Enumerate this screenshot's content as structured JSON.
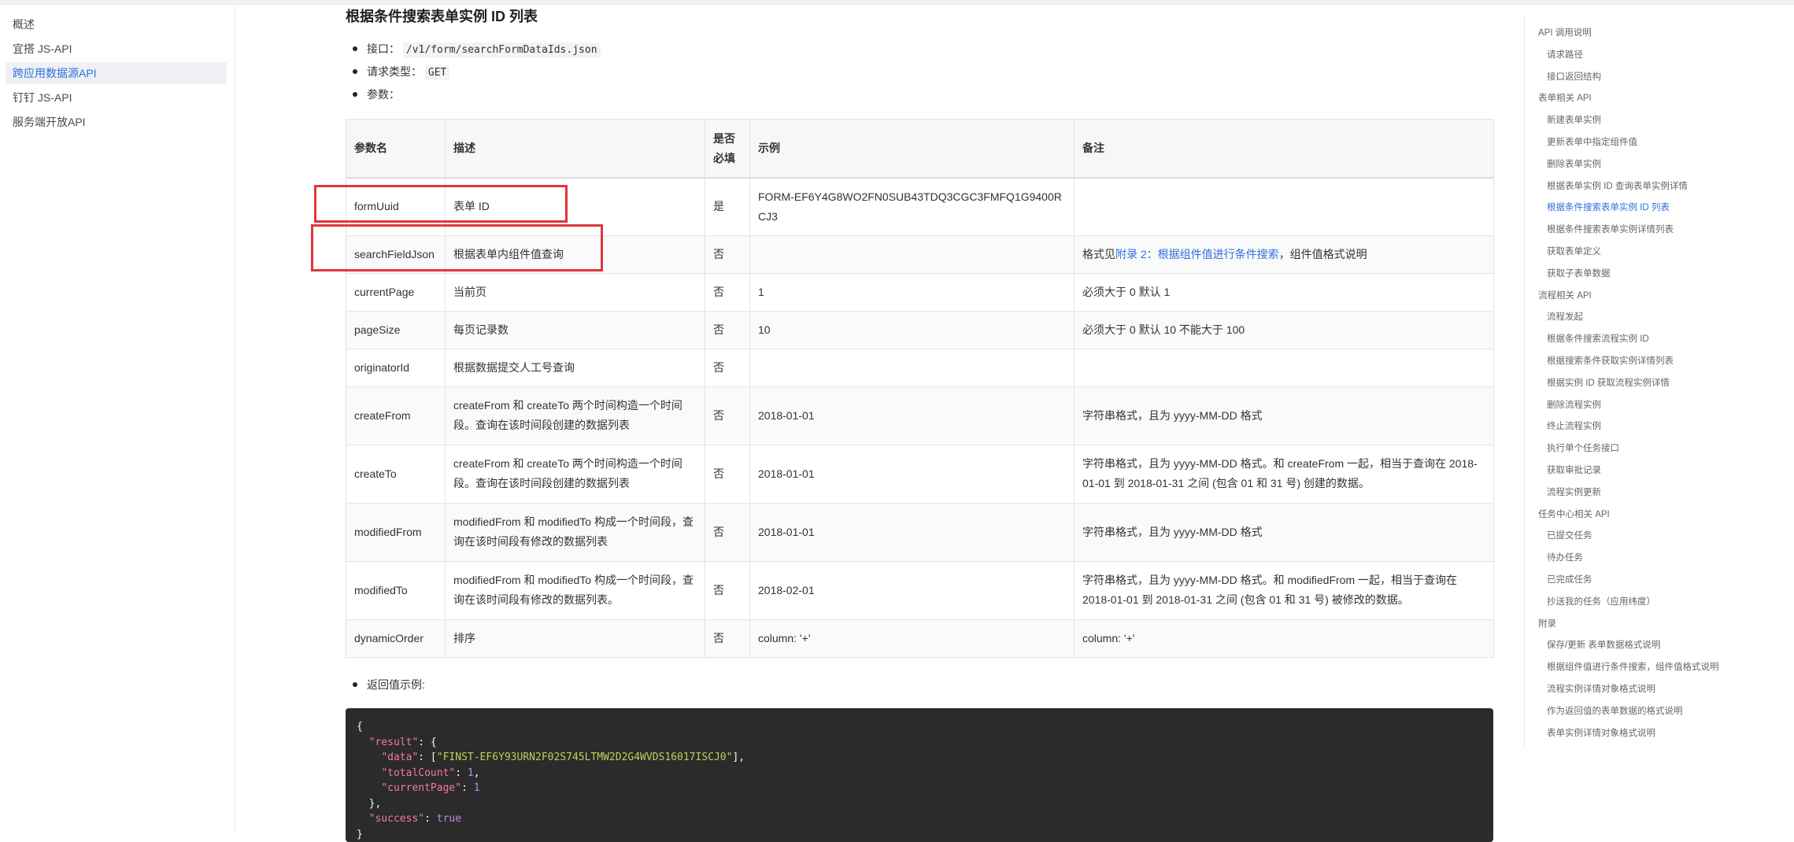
{
  "sidebar": {
    "items": [
      {
        "label": "概述",
        "active": false
      },
      {
        "label": "宜搭 JS-API",
        "active": false
      },
      {
        "label": "跨应用数据源API",
        "active": true
      },
      {
        "label": "钉钉 JS-API",
        "active": false
      },
      {
        "label": "服务端开放API",
        "active": false
      }
    ]
  },
  "main": {
    "title": "根据条件搜索表单实例 ID 列表",
    "endpoint_label": "接口：",
    "endpoint": "/v1/form/searchFormDataIds.json",
    "method_label": "请求类型：",
    "method": "GET",
    "params_label": "参数：",
    "table": {
      "headers": [
        "参数名",
        "描述",
        "是否必填",
        "示例",
        "备注"
      ],
      "rows": [
        {
          "name": "formUuid",
          "desc": "表单 ID",
          "required": "是",
          "example": "FORM-EF6Y4G8WO2FN0SUB43TDQ3CGC3FMFQ1G9400RCJ3",
          "note": ""
        },
        {
          "name": "searchFieldJson",
          "desc": "根据表单内组件值查询",
          "required": "否",
          "example": "",
          "note_pre": "格式见",
          "note_link": "附录 2：根据组件值进行条件搜索",
          "note_post": "，组件值格式说明"
        },
        {
          "name": "currentPage",
          "desc": "当前页",
          "required": "否",
          "example": "1",
          "note": "必须大于 0 默认 1"
        },
        {
          "name": "pageSize",
          "desc": "每页记录数",
          "required": "否",
          "example": "10",
          "note": "必须大于 0 默认 10 不能大于 100"
        },
        {
          "name": "originatorId",
          "desc": "根据数据提交人工号查询",
          "required": "否",
          "example": "",
          "note": ""
        },
        {
          "name": "createFrom",
          "desc": "createFrom 和 createTo 两个时间构造一个时间段。查询在该时间段创建的数据列表",
          "required": "否",
          "example": "2018-01-01",
          "note": "字符串格式，且为 yyyy-MM-DD 格式"
        },
        {
          "name": "createTo",
          "desc": "createFrom 和 createTo 两个时间构造一个时间段。查询在该时间段创建的数据列表",
          "required": "否",
          "example": "2018-01-01",
          "note": "字符串格式，且为 yyyy-MM-DD 格式。和 createFrom 一起，相当于查询在 2018-01-01 到 2018-01-31 之间 (包含 01 和 31 号) 创建的数据。"
        },
        {
          "name": "modifiedFrom",
          "desc": "modifiedFrom 和 modifiedTo 构成一个时间段，查询在该时间段有修改的数据列表",
          "required": "否",
          "example": "2018-01-01",
          "note": "字符串格式，且为 yyyy-MM-DD 格式"
        },
        {
          "name": "modifiedTo",
          "desc": "modifiedFrom 和 modifiedTo 构成一个时间段，查询在该时间段有修改的数据列表。",
          "required": "否",
          "example": "2018-02-01",
          "note": "字符串格式，且为 yyyy-MM-DD 格式。和 modifiedFrom 一起，相当于查询在 2018-01-01 到 2018-01-31 之间 (包含 01 和 31 号) 被修改的数据。"
        },
        {
          "name": "dynamicOrder",
          "desc": "排序",
          "required": "否",
          "example": "column: '+'",
          "note": "column: '+'"
        }
      ]
    },
    "return_label": "返回值示例:",
    "code": {
      "open": "{",
      "result_key": "\"result\"",
      "data_key": "\"data\"",
      "data_val": "\"FINST-EF6Y93URN2F02S745LTMW2D2G4WVDS16017ISCJ0\"",
      "total_key": "\"totalCount\"",
      "total_val": "1",
      "current_key": "\"currentPage\"",
      "current_val": "1",
      "success_key": "\"success\"",
      "success_val": "true",
      "close": "}"
    }
  },
  "toc": {
    "items": [
      {
        "label": "API 调用说明",
        "level": 1
      },
      {
        "label": "请求路径",
        "level": 2
      },
      {
        "label": "接口返回结构",
        "level": 2
      },
      {
        "label": "表单相关 API",
        "level": 1
      },
      {
        "label": "新建表单实例",
        "level": 2
      },
      {
        "label": "更新表单中指定组件值",
        "level": 2
      },
      {
        "label": "删除表单实例",
        "level": 2
      },
      {
        "label": "根据表单实例 ID 查询表单实例详情",
        "level": 2
      },
      {
        "label": "根据条件搜索表单实例 ID 列表",
        "level": 2,
        "active": true
      },
      {
        "label": "根据条件搜索表单实例详情列表",
        "level": 2
      },
      {
        "label": "获取表单定义",
        "level": 2
      },
      {
        "label": "获取子表单数据",
        "level": 2
      },
      {
        "label": "流程相关 API",
        "level": 1
      },
      {
        "label": "流程发起",
        "level": 2
      },
      {
        "label": "根据条件搜索流程实例 ID",
        "level": 2
      },
      {
        "label": "根据搜索条件获取实例详情列表",
        "level": 2
      },
      {
        "label": "根据实例 ID 获取流程实例详情",
        "level": 2
      },
      {
        "label": "删除流程实例",
        "level": 2
      },
      {
        "label": "终止流程实例",
        "level": 2
      },
      {
        "label": "执行单个任务接口",
        "level": 2
      },
      {
        "label": "获取审批记录",
        "level": 2
      },
      {
        "label": "流程实例更新",
        "level": 2
      },
      {
        "label": "任务中心相关 API",
        "level": 1
      },
      {
        "label": "已提交任务",
        "level": 2
      },
      {
        "label": "待办任务",
        "level": 2
      },
      {
        "label": "已完成任务",
        "level": 2
      },
      {
        "label": "抄送我的任务（应用纬度）",
        "level": 2
      },
      {
        "label": "附录",
        "level": 1
      },
      {
        "label": "保存/更新 表单数据格式说明",
        "level": 2
      },
      {
        "label": "根据组件值进行条件搜索，组件值格式说明",
        "level": 2
      },
      {
        "label": "流程实例详情对象格式说明",
        "level": 2
      },
      {
        "label": "作为返回值的表单数据的格式说明",
        "level": 2
      },
      {
        "label": "表单实例详情对象格式说明",
        "level": 2
      }
    ]
  },
  "colors": {
    "accent": "#2f6fe0",
    "highlight": "#e0363c",
    "code_bg": "#2b2b2b"
  }
}
